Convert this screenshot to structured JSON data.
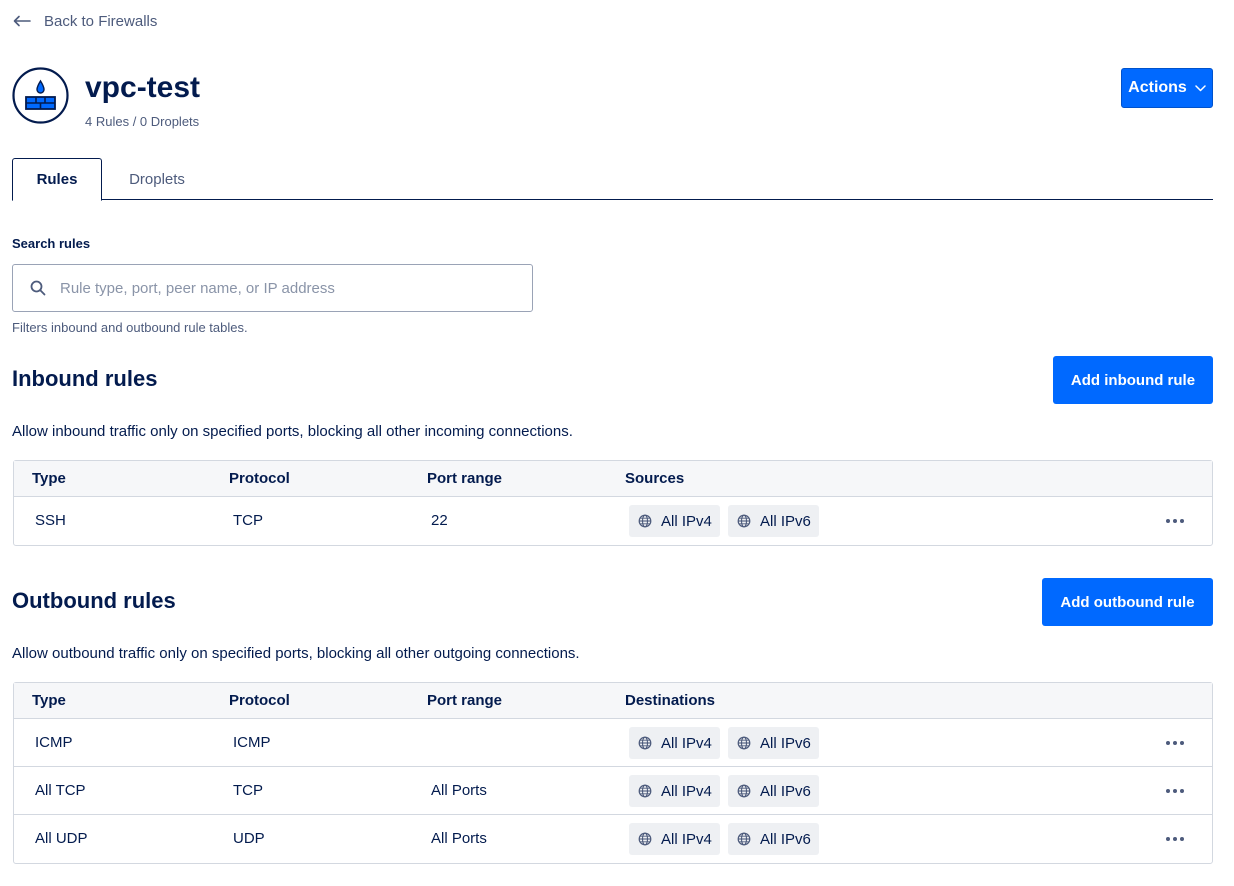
{
  "nav": {
    "back_label": "Back to Firewalls"
  },
  "header": {
    "title": "vpc-test",
    "subtitle": "4 Rules / 0 Droplets",
    "actions_label": "Actions"
  },
  "tabs": [
    {
      "label": "Rules",
      "active": true
    },
    {
      "label": "Droplets",
      "active": false
    }
  ],
  "search": {
    "label": "Search rules",
    "placeholder": "Rule type, port, peer name, or IP address",
    "value": "",
    "help": "Filters inbound and outbound rule tables."
  },
  "inbound": {
    "title": "Inbound rules",
    "add_label": "Add inbound rule",
    "description": "Allow inbound traffic only on specified ports, blocking all other incoming connections.",
    "columns": [
      "Type",
      "Protocol",
      "Port range",
      "Sources"
    ],
    "rows": [
      {
        "type": "SSH",
        "protocol": "TCP",
        "port": "22",
        "peers": [
          "All IPv4",
          "All IPv6"
        ]
      }
    ]
  },
  "outbound": {
    "title": "Outbound rules",
    "add_label": "Add outbound rule",
    "description": "Allow outbound traffic only on specified ports, blocking all other outgoing connections.",
    "columns": [
      "Type",
      "Protocol",
      "Port range",
      "Destinations"
    ],
    "rows": [
      {
        "type": "ICMP",
        "protocol": "ICMP",
        "port": "",
        "peers": [
          "All IPv4",
          "All IPv6"
        ]
      },
      {
        "type": "All TCP",
        "protocol": "TCP",
        "port": "All Ports",
        "peers": [
          "All IPv4",
          "All IPv6"
        ]
      },
      {
        "type": "All UDP",
        "protocol": "UDP",
        "port": "All Ports",
        "peers": [
          "All IPv4",
          "All IPv6"
        ]
      }
    ]
  },
  "icons": {
    "back": "arrow-left-icon",
    "firewall": "firewall-icon",
    "actions": "chevron-down-icon",
    "search": "search-icon",
    "peer": "globe-icon",
    "row_menu": "more-icon"
  },
  "colors": {
    "primary": "#0069ff",
    "text": "#031b4e",
    "muted": "#4d5b7c",
    "border": "#d3d8e0",
    "chip_bg": "#eef0f3"
  }
}
